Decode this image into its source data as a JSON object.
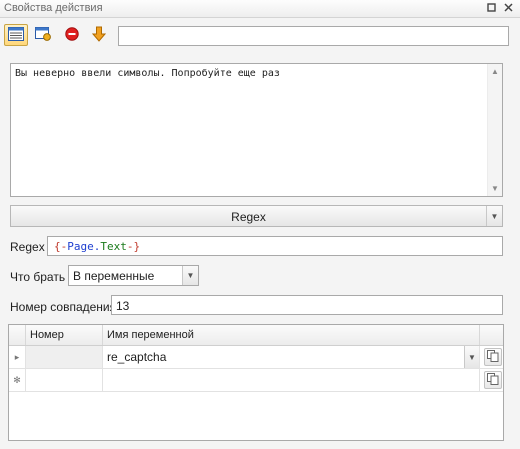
{
  "panel": {
    "title": "Свойства действия"
  },
  "toolbar": {
    "buttons": [
      {
        "icon": "properties-icon",
        "active": true
      },
      {
        "icon": "settings-icon",
        "active": false
      },
      {
        "icon": "stop-icon",
        "active": false
      },
      {
        "icon": "arrow-down-icon",
        "active": false
      }
    ],
    "input_value": ""
  },
  "message": {
    "text": "Вы неверно ввели символы. Попробуйте еще раз"
  },
  "mode_combo": {
    "value": "Regex"
  },
  "regex": {
    "label": "Regex",
    "value_parts": {
      "open": "{-",
      "page": "Page",
      "dot": ".",
      "text": "Text",
      "close": "-}"
    }
  },
  "take": {
    "label": "Что брать",
    "value": "В переменные"
  },
  "match_number": {
    "label": "Номер совпадения",
    "value": "13"
  },
  "grid": {
    "columns": [
      "Номер",
      "Имя переменной"
    ],
    "rows": [
      {
        "indicator": "▸",
        "number": "",
        "variable": "re_captcha"
      },
      {
        "indicator": "✻",
        "number": "",
        "variable": ""
      }
    ]
  },
  "colors": {
    "accent": "#ffd77a",
    "stop": "#e02020",
    "arrow": "#f0a020"
  }
}
